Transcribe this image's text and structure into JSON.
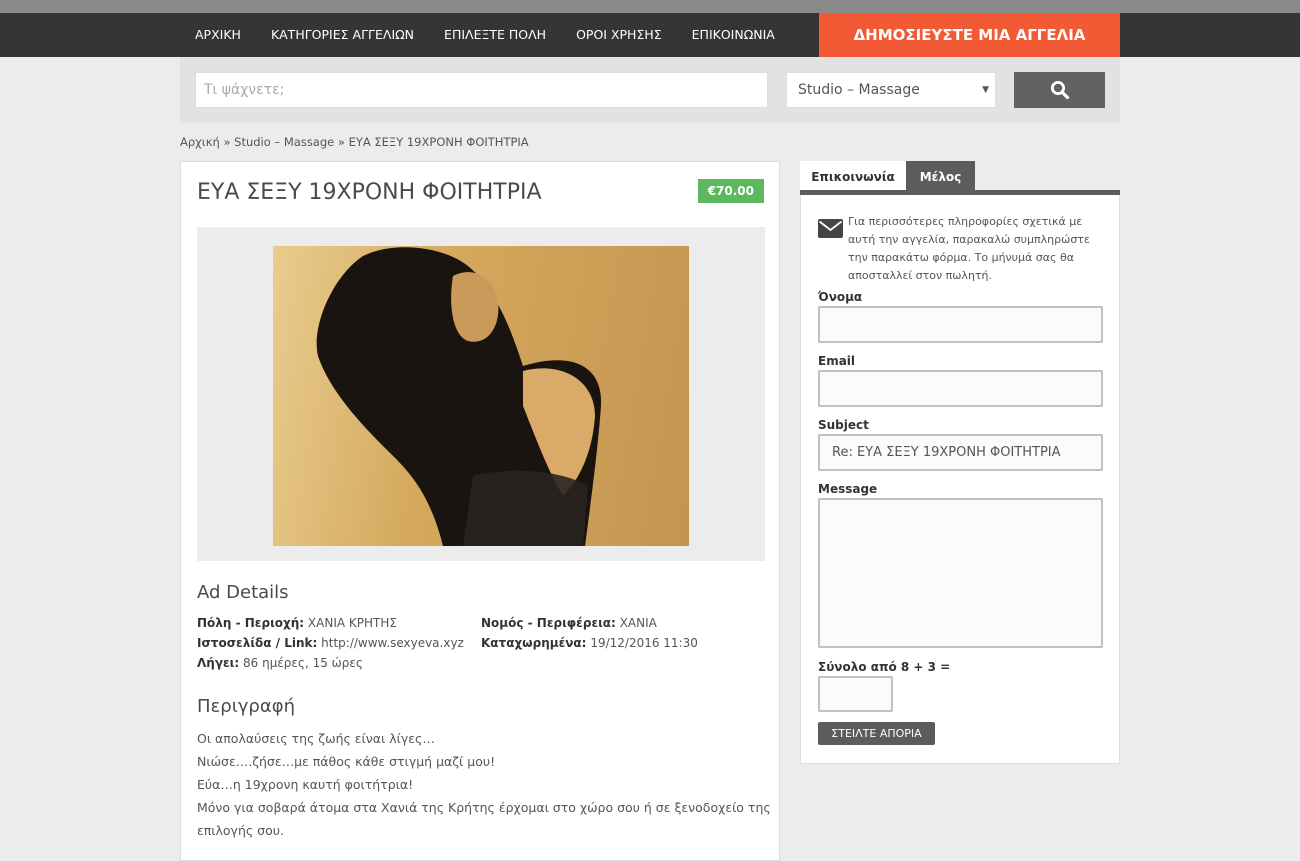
{
  "nav": {
    "items": [
      "ΑΡΧΙΚΗ",
      "ΚΑΤΗΓΟΡΙΕΣ ΑΓΓΕΛΙΩΝ",
      "ΕΠΙΛΕΞΤΕ ΠΟΛΗ",
      "ΟΡΟΙ ΧΡΗΣΗΣ",
      "ΕΠΙΚΟΙΝΩΝΙΑ"
    ],
    "post_ad": "ΔΗΜΟΣΙΕΥΣΤΕ ΜΙΑ ΑΓΓΕΛΙΑ"
  },
  "search": {
    "placeholder": "Τι ψάχνετε;",
    "category": "Studio – Massage",
    "button_icon": "search-icon"
  },
  "breadcrumb": {
    "home": "Αρχική",
    "sep": "»",
    "category": "Studio – Massage",
    "current": "ΕΥΑ ΣΕΞΥ 19ΧΡΟΝΗ ΦΟΙΤΗΤΡΙΑ"
  },
  "ad": {
    "title": "ΕΥΑ ΣΕΞΥ 19ΧΡΟΝΗ ΦΟΙΤΗΤΡΙΑ",
    "price": "€70.00",
    "details_heading": "Ad Details",
    "details": {
      "city_label": "Πόλη - Περιοχή:",
      "city_value": "ΧΑΝΙΑ ΚΡΗΤΗΣ",
      "prefecture_label": "Νομός - Περιφέρεια:",
      "prefecture_value": "ΧΑΝΙΑ",
      "website_label": "Ιστοσελίδα / Link:",
      "website_value": "http://www.sexyeva.xyz",
      "listed_label": "Καταχωρημένα:",
      "listed_value": "19/12/2016 11:30",
      "expires_label": "Λήγει:",
      "expires_value": "86 ημέρες, 15 ώρες"
    },
    "description_heading": "Περιγραφή",
    "description_lines": [
      "Οι απολαύσεις της ζωής είναι λίγες…",
      "Νιώσε….ζήσε…με πάθος κάθε στιγμή μαζί μου!",
      "Εύα…η 19χρονη καυτή φοιτήτρια!",
      "Μόνο για σοβαρά άτομα στα Χανιά της Κρήτης έρχομαι στο χώρο σου ή σε ξενοδοχείο της",
      "επιλογής σου."
    ]
  },
  "sidebar": {
    "tabs": [
      "Επικοινωνία",
      "Μέλος"
    ],
    "info": "Για περισσότερες πληροφορίες σχετικά με αυτή την αγγελία, παρακαλώ συμπληρώστε την παρακάτω φόρμα. Το μήνυμά σας θα αποσταλλεί στον πωλητή.",
    "name_label": "Όνομα",
    "email_label": "Email",
    "subject_label": "Subject",
    "subject_value": "Re: ΕΥΑ ΣΕΞΥ 19ΧΡΟΝΗ ΦΟΙΤΗΤΡΙΑ",
    "message_label": "Message",
    "captcha_label": "Σύνολο από 8 + 3 =",
    "send": "ΣΤΕΙΛΤΕ ΑΠΟΡΙΑ"
  }
}
